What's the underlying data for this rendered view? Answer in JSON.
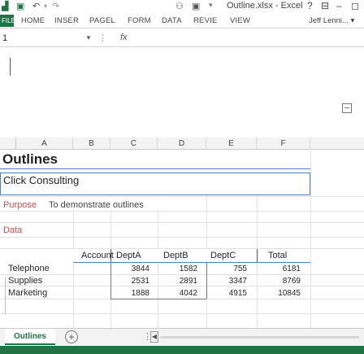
{
  "titlebar": {
    "filename": "Outline.xlsx - Excel",
    "help": "?",
    "minimize": "–",
    "restore": "◻",
    "quick_access": [
      "Save",
      "Undo",
      "Redo",
      "Options"
    ]
  },
  "ribbon": {
    "file_label": "FILE",
    "tabs": [
      "HOME",
      "INSER",
      "PAGEL",
      "FORM",
      "DATA",
      "REVIE",
      "VIEW"
    ],
    "user": "Jeff Lenni..."
  },
  "formula_bar": {
    "name_box": "1",
    "fx": "fx",
    "value": ""
  },
  "columns": [
    "A",
    "B",
    "C",
    "D",
    "E",
    "F"
  ],
  "sheet": {
    "title": "Outlines",
    "company": "Click Consulting",
    "purpose_label": "Purpose",
    "purpose_text": "To demonstrate outlines",
    "data_label": "Data",
    "table": {
      "headers": [
        "Account",
        "DeptA",
        "DeptB",
        "DeptC",
        "Total"
      ],
      "rows": [
        {
          "account": "Telephone",
          "a": "3844",
          "b": "1582",
          "c": "755",
          "total": "6181"
        },
        {
          "account": "Supplies",
          "a": "2531",
          "b": "2891",
          "c": "3347",
          "total": "8769"
        },
        {
          "account": "Marketing",
          "a": "1888",
          "b": "4042",
          "c": "4915",
          "total": "10845"
        }
      ]
    }
  },
  "sheet_tabs": {
    "active": "Outlines",
    "add": "+"
  },
  "colors": {
    "excel_green": "#217346",
    "title_rule": "#4f81bd",
    "label_red": "#c0504d"
  }
}
